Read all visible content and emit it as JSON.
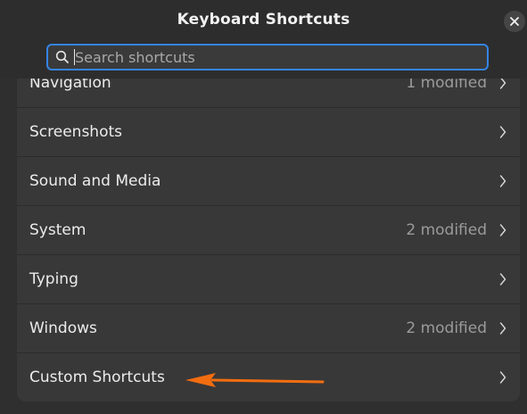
{
  "window": {
    "title": "Keyboard Shortcuts"
  },
  "search": {
    "placeholder": "Search shortcuts",
    "value": ""
  },
  "rows": [
    {
      "label": "Navigation",
      "status": "1 modified"
    },
    {
      "label": "Screenshots",
      "status": ""
    },
    {
      "label": "Sound and Media",
      "status": ""
    },
    {
      "label": "System",
      "status": "2 modified"
    },
    {
      "label": "Typing",
      "status": ""
    },
    {
      "label": "Windows",
      "status": "2 modified"
    },
    {
      "label": "Custom Shortcuts",
      "status": ""
    }
  ],
  "icons": {
    "close": "close-icon",
    "search": "search-icon",
    "chevron": "chevron-right-icon",
    "annotation": "orange-arrow"
  },
  "colors": {
    "accent": "#3584e4",
    "annotation": "#f36d10"
  }
}
